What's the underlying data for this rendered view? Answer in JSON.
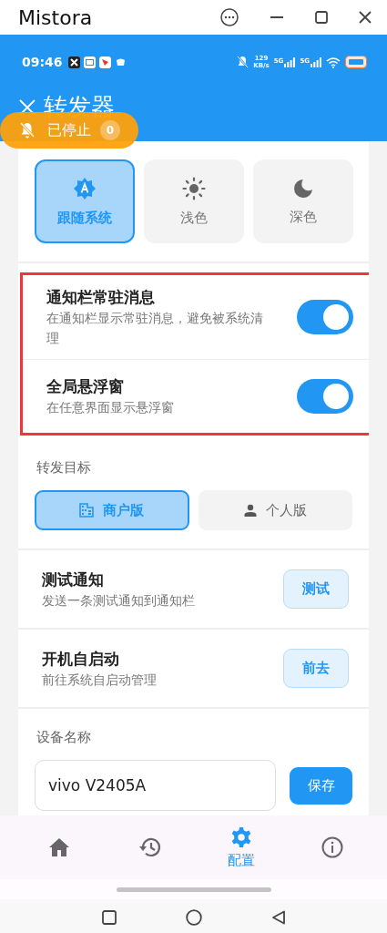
{
  "window": {
    "title": "Mistora"
  },
  "status_bar": {
    "time": "09:46",
    "net_speed": "129",
    "net_unit": "KB/s",
    "signal_labels": [
      "5G",
      "5G"
    ]
  },
  "header": {
    "title": "转发器"
  },
  "status_pill": {
    "label": "已停止",
    "count": "0"
  },
  "theme_options": [
    {
      "label": "跟随系统",
      "kind": "auto",
      "selected": true
    },
    {
      "label": "浅色",
      "kind": "light",
      "selected": false
    },
    {
      "label": "深色",
      "kind": "dark",
      "selected": false
    }
  ],
  "toggles": [
    {
      "title": "通知栏常驻消息",
      "description": "在通知栏显示常驻消息，避免被系统清理",
      "on": true
    },
    {
      "title": "全局悬浮窗",
      "description": "在任意界面显示悬浮窗",
      "on": true
    }
  ],
  "forward_target": {
    "label": "转发目标",
    "options": [
      {
        "label": "商户版",
        "kind": "shop",
        "selected": true
      },
      {
        "label": "个人版",
        "kind": "person",
        "selected": false
      }
    ]
  },
  "actions": [
    {
      "title": "测试通知",
      "description": "发送一条测试通知到通知栏",
      "button": "测试"
    },
    {
      "title": "开机自启动",
      "description": "前往系统自启动管理",
      "button": "前去"
    }
  ],
  "device_name": {
    "label": "设备名称",
    "value": "vivo V2405A",
    "button": "保存"
  },
  "bottom_nav": [
    {
      "kind": "home",
      "selected": false
    },
    {
      "kind": "history",
      "selected": false
    },
    {
      "kind": "settings",
      "label": "配置",
      "selected": true
    },
    {
      "kind": "info",
      "selected": false
    }
  ]
}
